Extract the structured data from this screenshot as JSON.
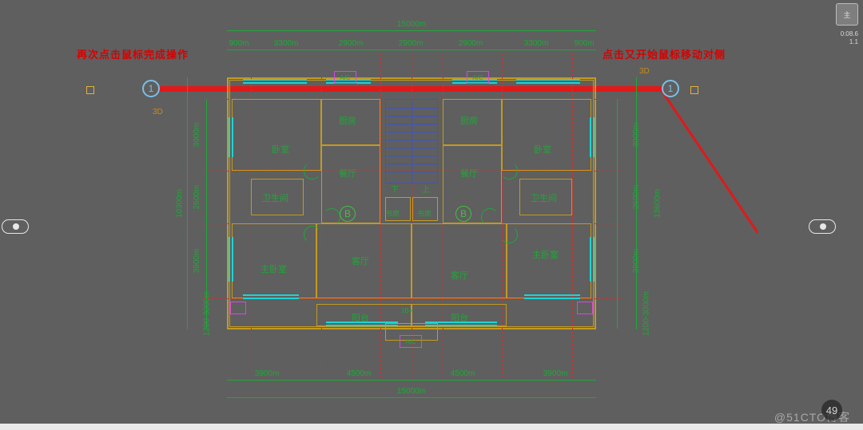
{
  "annotations": {
    "left": "再次点击鼠标完成操作",
    "right": "点击又开始鼠标移动对侧"
  },
  "grid_bubbles": {
    "one_l": "1",
    "one_r": "1",
    "b1": "B",
    "b2": "B"
  },
  "markers": {
    "threeD": "3D"
  },
  "dims": {
    "top_total": "15000m",
    "top_segs": [
      "900m",
      "3300m",
      "2900m",
      "2900m",
      "2900m",
      "3300m",
      "900m"
    ],
    "bottom_total": "15000m",
    "bottom_segs": [
      "3900m",
      "4500m",
      "4500m",
      "3900m"
    ],
    "left_total": "10300m",
    "left_segs": [
      "3900m",
      "2600m",
      "3900m",
      "1200-3000m"
    ],
    "right_total": "13600m",
    "right_segs": [
      "3900m",
      "2600m",
      "3900m",
      "1200-3000m"
    ]
  },
  "rooms": {
    "kitchen_l": "厨房",
    "kitchen_r": "厨房",
    "bedroom_tl": "卧室",
    "bedroom_tr": "卧室",
    "dining_l": "餐厅",
    "dining_r": "餐厅",
    "bath_l": "卫生间",
    "bath_r": "卫生间",
    "master_l": "主卧室",
    "master_r": "主卧室",
    "living_l": "客厅",
    "living_r": "客厅",
    "balcony_l": "阳台",
    "balcony_r": "阳台"
  },
  "stairs": {
    "down": "下",
    "up": "上"
  },
  "misc": {
    "shufang_l": "书房",
    "shufang_r": "书房",
    "elev_mark": "1B+"
  },
  "ac_label": "A/C",
  "viewcube": "主",
  "watermark": "@51CTO博客",
  "page": "49",
  "stat": {
    "l1": "0:08.6",
    "l2": "1.1"
  }
}
